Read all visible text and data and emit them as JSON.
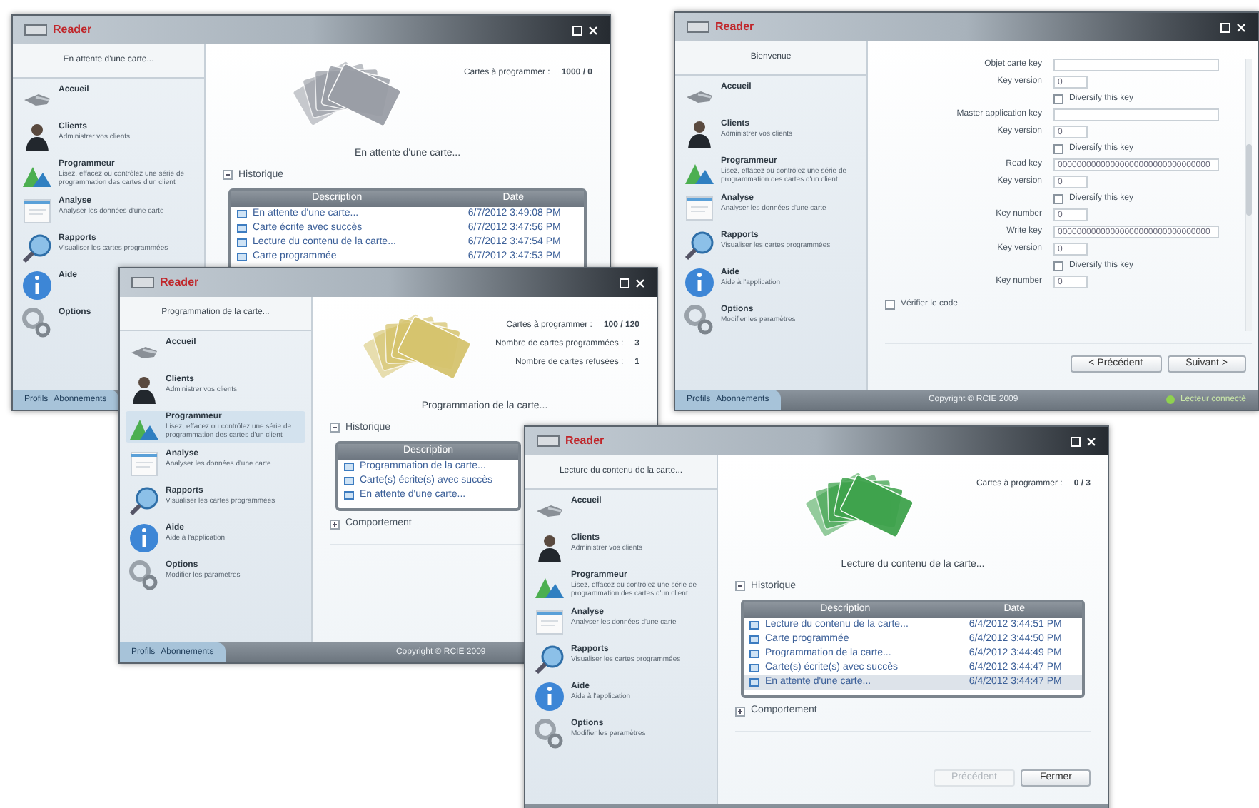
{
  "windows": [
    {
      "kind": "status",
      "logo": "Reader",
      "color": "#9a9ea6",
      "sidebar": {
        "header": "En attente d'une carte...",
        "items": [
          {
            "title": "Accueil",
            "selected": false
          },
          {
            "title": "Clients",
            "desc": "Administrer vos clients",
            "selected": false
          },
          {
            "title": "Programmeur",
            "desc": "Lisez, effacez ou contrôlez une série de programmation des cartes d'un client",
            "selected": false
          },
          {
            "title": "Analyse",
            "desc": "Analyser les données d'une carte",
            "selected": false
          },
          {
            "title": "Rapports",
            "desc": "Visualiser les cartes programmées",
            "selected": false
          },
          {
            "title": "Aide",
            "selected": false
          },
          {
            "title": "Options",
            "selected": false
          }
        ]
      },
      "stats": [
        {
          "label": "Cartes à programmer :",
          "value": "1000 / 0"
        }
      ],
      "caption": "En attente d'une carte...",
      "history": {
        "label": "Historique",
        "expanded": true
      },
      "table": {
        "columns": [
          "Description",
          "Date"
        ],
        "rows": [
          {
            "cells": [
              "En attente d'une carte...",
              "6/7/2012 3:49:08 PM"
            ],
            "selected": false
          },
          {
            "cells": [
              "Carte écrite avec succès",
              "6/7/2012 3:47:56 PM"
            ],
            "selected": false
          },
          {
            "cells": [
              "Lecture du contenu de la carte...",
              "6/7/2012 3:47:54 PM"
            ],
            "selected": false
          },
          {
            "cells": [
              "Carte programmée",
              "6/7/2012 3:47:53 PM"
            ],
            "selected": false
          }
        ]
      },
      "footer": {
        "links": [
          "Profils",
          "Abonnements"
        ]
      }
    },
    {
      "kind": "form",
      "logo": "Reader",
      "sidebar": {
        "header": "Bienvenue",
        "items": [
          {
            "title": "Accueil",
            "selected": false
          },
          {
            "title": "Clients",
            "desc": "Administrer vos clients",
            "selected": false
          },
          {
            "title": "Programmeur",
            "desc": "Lisez, effacez ou contrôlez une série de programmation des cartes d'un client",
            "selected": false
          },
          {
            "title": "Analyse",
            "desc": "Analyser les données d'une carte",
            "selected": false
          },
          {
            "title": "Rapports",
            "desc": "Visualiser les cartes programmées",
            "selected": false
          },
          {
            "title": "Aide",
            "desc": "Aide à l'application",
            "selected": false
          },
          {
            "title": "Options",
            "desc": "Modifier les paramètres",
            "selected": false
          }
        ]
      },
      "fields": [
        {
          "kind": "keyinput",
          "label": "Objet carte key"
        },
        {
          "kind": "numinput",
          "label": "Key version",
          "value": "0"
        },
        {
          "kind": "checkbox",
          "label": "Diversify this key",
          "checked": false
        },
        {
          "kind": "keyinput",
          "label": "Master application key"
        },
        {
          "kind": "numinput",
          "label": "Key version",
          "value": "0"
        },
        {
          "kind": "checkbox",
          "label": "Diversify this key",
          "checked": false
        },
        {
          "kind": "keyinput",
          "label": "Read key",
          "value": "00000000000000000000000000000000"
        },
        {
          "kind": "numinput",
          "label": "Key version",
          "value": "0"
        },
        {
          "kind": "checkbox",
          "label": "Diversify this key",
          "checked": false
        },
        {
          "kind": "numinput",
          "label": "Key number",
          "value": "0"
        },
        {
          "kind": "keyinput",
          "label": "Write key",
          "value": "00000000000000000000000000000000"
        },
        {
          "kind": "numinput",
          "label": "Key version",
          "value": "0"
        },
        {
          "kind": "checkbox",
          "label": "Diversify this key",
          "checked": false
        },
        {
          "kind": "numinput",
          "label": "Key number",
          "value": "0"
        }
      ],
      "option": {
        "label": "Vérifier le code",
        "checked": false
      },
      "buttons": [
        {
          "label": "< Précédent",
          "disabled": false
        },
        {
          "label": "Suivant >",
          "disabled": false
        }
      ],
      "footer": {
        "links": [
          "Profils",
          "Abonnements"
        ],
        "copyright": "Copyright © RCIE 2009",
        "status": "Lecteur connecté"
      }
    },
    {
      "kind": "status",
      "logo": "Reader",
      "color": "#d6c46e",
      "sidebar": {
        "header": "Programmation de la carte...",
        "items": [
          {
            "title": "Accueil",
            "selected": false
          },
          {
            "title": "Clients",
            "desc": "Administrer vos clients",
            "selected": false
          },
          {
            "title": "Programmeur",
            "desc": "Lisez, effacez ou contrôlez une série de programmation des cartes d'un client",
            "selected": true
          },
          {
            "title": "Analyse",
            "desc": "Analyser les données d'une carte",
            "selected": false
          },
          {
            "title": "Rapports",
            "desc": "Visualiser les cartes programmées",
            "selected": false
          },
          {
            "title": "Aide",
            "desc": "Aide à l'application",
            "selected": false
          },
          {
            "title": "Options",
            "desc": "Modifier les paramètres",
            "selected": false
          }
        ]
      },
      "stats": [
        {
          "label": "Cartes à programmer :",
          "value": "100 / 120"
        },
        {
          "label": "Nombre de cartes programmées :",
          "value": "3"
        },
        {
          "label": "Nombre de cartes refusées :",
          "value": "1"
        }
      ],
      "caption": "Programmation de la carte...",
      "history": {
        "label": "Historique",
        "expanded": true
      },
      "table": {
        "columns": [
          "Description"
        ],
        "rows": [
          {
            "cells": [
              "Programmation de la carte..."
            ],
            "selected": false
          },
          {
            "cells": [
              "Carte(s) écrite(s) avec succès"
            ],
            "selected": false
          },
          {
            "cells": [
              "En attente d'une carte..."
            ],
            "selected": false
          }
        ]
      },
      "behaviour": {
        "label": "Comportement",
        "expanded": false
      },
      "footer": {
        "links": [
          "Profils",
          "Abonnements"
        ],
        "copyright": "Copyright © RCIE 2009"
      }
    },
    {
      "kind": "status",
      "logo": "Reader",
      "color": "#3fa34d",
      "sidebar": {
        "header": "Lecture du contenu de la carte...",
        "items": [
          {
            "title": "Accueil",
            "selected": false
          },
          {
            "title": "Clients",
            "desc": "Administrer vos clients",
            "selected": false
          },
          {
            "title": "Programmeur",
            "desc": "Lisez, effacez ou contrôlez une série de programmation des cartes d'un client",
            "selected": false
          },
          {
            "title": "Analyse",
            "desc": "Analyser les données d'une carte",
            "selected": false
          },
          {
            "title": "Rapports",
            "desc": "Visualiser les cartes programmées",
            "selected": false
          },
          {
            "title": "Aide",
            "desc": "Aide à l'application",
            "selected": false
          },
          {
            "title": "Options",
            "desc": "Modifier les paramètres",
            "selected": false
          }
        ]
      },
      "stats": [
        {
          "label": "Cartes à programmer :",
          "value": "0 / 3"
        }
      ],
      "caption": "Lecture du contenu de la carte...",
      "history": {
        "label": "Historique",
        "expanded": true
      },
      "table": {
        "columns": [
          "Description",
          "Date"
        ],
        "rows": [
          {
            "cells": [
              "Lecture du contenu de la carte...",
              "6/4/2012 3:44:51 PM"
            ],
            "selected": false
          },
          {
            "cells": [
              "Carte programmée",
              "6/4/2012 3:44:50 PM"
            ],
            "selected": false
          },
          {
            "cells": [
              "Programmation de la carte...",
              "6/4/2012 3:44:49 PM"
            ],
            "selected": false
          },
          {
            "cells": [
              "Carte(s) écrite(s) avec succès",
              "6/4/2012 3:44:47 PM"
            ],
            "selected": false
          },
          {
            "cells": [
              "En attente d'une carte...",
              "6/4/2012 3:44:47 PM"
            ],
            "selected": true
          }
        ]
      },
      "behaviour": {
        "label": "Comportement",
        "expanded": false
      },
      "buttons": [
        {
          "label": "Précédent",
          "disabled": true
        },
        {
          "label": "Fermer",
          "disabled": false
        }
      ]
    }
  ]
}
